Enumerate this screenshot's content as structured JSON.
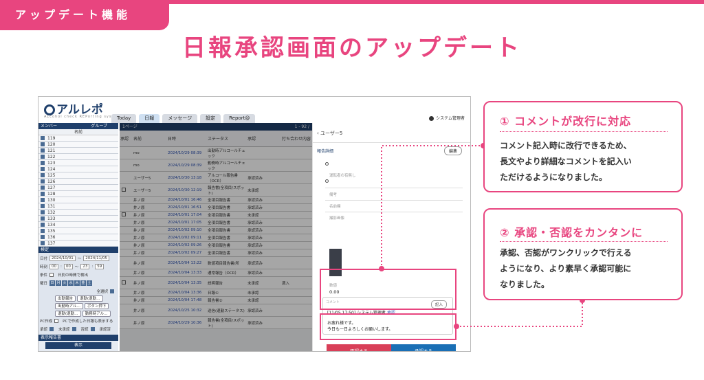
{
  "tag": "アップデート機能",
  "headline": "日報承認画面のアップデート",
  "app": {
    "logo": "アルレポ",
    "logo_sub": "ALcohol check REPorting system",
    "tabs": [
      "Today",
      "日報",
      "メッセージ",
      "設定",
      "Report@"
    ],
    "user": "システム管理者"
  },
  "sidebar": {
    "header": "メンバー",
    "group_label": "グループ",
    "col": "名前",
    "members": [
      "119",
      "120",
      "121",
      "122",
      "123",
      "124",
      "125",
      "126",
      "127",
      "128",
      "130",
      "131",
      "132",
      "133",
      "134",
      "135",
      "136",
      "137"
    ],
    "filter_label": "検定",
    "date_label": "日付",
    "date_from": "2024/10/01",
    "date_to": "2024/11/05",
    "time_label": "時刻",
    "hour_from": "00",
    "min_from": "00",
    "hour_to": "23",
    "min_to": "59",
    "cond_label": "条件",
    "cond_text": "日別の時間で検出",
    "weekday_label": "曜日",
    "weekdays": [
      "日",
      "月",
      "火",
      "水",
      "木",
      "金",
      "土"
    ],
    "select_all": "全選択",
    "chips": [
      "出勤報告",
      "退勤(退勤…",
      "出勤時アル…",
      "ボタン押下",
      "退勤(退勤…",
      "勤務時アル…"
    ],
    "pc_label": "PC作成",
    "pc_text": "PCで作成した日報も表示する",
    "approve_label": "承認",
    "approve_opts": [
      "未承認",
      "否認",
      "承認済"
    ],
    "report_label": "表示報告書",
    "show_button": "表示",
    "note_label": "日付報告書"
  },
  "main": {
    "header": "1ページ",
    "page": "1 - 92 /",
    "cols": [
      "承認",
      "名前",
      "日時",
      "ステータス",
      "承認",
      "打ち合わせ内容"
    ],
    "rows": [
      {
        "name": "mo",
        "date": "2024/10/29 08:39",
        "status": "出勤時アルコールチェック",
        "approve": "",
        "note": ""
      },
      {
        "name": "mo",
        "date": "2024/10/29 08:39",
        "status": "勤務時アルコールチェック",
        "approve": "",
        "note": ""
      },
      {
        "name": "ユーザー5",
        "date": "2024/10/30 13:18",
        "status": "アルコール報告書（OCR）",
        "approve": "承認済み",
        "note": ""
      },
      {
        "name": "ユーザー5",
        "date": "2024/10/30 12:19",
        "status": "報告書(全項目/スポット)",
        "approve": "未承認",
        "note": ""
      },
      {
        "name": "井ノ原",
        "date": "2024/10/01 16:46",
        "status": "全項目報告書",
        "approve": "承認済み",
        "note": ""
      },
      {
        "name": "井ノ原",
        "date": "2024/10/01 16:51",
        "status": "全項目報告書",
        "approve": "承認済み",
        "note": ""
      },
      {
        "name": "井ノ原",
        "date": "2024/10/01 17:04",
        "status": "全項目報告書",
        "approve": "未承認",
        "note": ""
      },
      {
        "name": "井ノ原",
        "date": "2024/10/01 17:05",
        "status": "全項目報告書",
        "approve": "承認済み",
        "note": ""
      },
      {
        "name": "井ノ原",
        "date": "2024/10/02 09:10",
        "status": "全項目報告書",
        "approve": "承認済み",
        "note": ""
      },
      {
        "name": "井ノ原",
        "date": "2024/10/02 09:11",
        "status": "全項目報告書",
        "approve": "承認済み",
        "note": ""
      },
      {
        "name": "井ノ原",
        "date": "2024/10/02 09:26",
        "status": "全項目報告書",
        "approve": "承認済み",
        "note": ""
      },
      {
        "name": "井ノ原",
        "date": "2024/10/02 09:27",
        "status": "全項目報告書",
        "approve": "承認済み",
        "note": ""
      },
      {
        "name": "井ノ原",
        "date": "2024/10/04 13:22",
        "status": "数値項目報告書/所",
        "approve": "承認済み",
        "note": ""
      },
      {
        "name": "井ノ原",
        "date": "2024/10/04 13:33",
        "status": "通常報告（OCR）",
        "approve": "承認済み",
        "note": ""
      },
      {
        "name": "井ノ原",
        "date": "2024/10/04 13:35",
        "status": "説明報告",
        "approve": "未承認",
        "note": "週入"
      },
      {
        "name": "井ノ原",
        "date": "2024/10/04 13:36",
        "status": "日報①",
        "approve": "未承認",
        "note": ""
      },
      {
        "name": "井ノ原",
        "date": "2024/10/04 17:48",
        "status": "報告書②",
        "approve": "未承認",
        "note": ""
      },
      {
        "name": "井ノ原",
        "date": "2024/10/25 10:32",
        "status": "送信(退勤ステータス)",
        "approve": "承認済み",
        "note": ""
      },
      {
        "name": "井ノ原",
        "date": "2024/10/29 10:36",
        "status": "報告書(全項目/スポット)",
        "approve": "承認済み",
        "note": ""
      }
    ]
  },
  "panel": {
    "back": "ユーザー5",
    "section": "報告詳細",
    "edit": "編集",
    "labels": [
      "運転者の有無し",
      "備考",
      "名前欄",
      "撮影画像"
    ],
    "value_label": "数値",
    "value": "0.00",
    "comment_label": "コメント",
    "comment_button": "記入",
    "comment_time": "[11/05 17:50] システム管理者",
    "comment_status": "承認",
    "comment_body_1": "お疲れ様です。",
    "comment_body_2": "今日も一日よろしくお願いします。",
    "deny_button": "否認する",
    "approve_button": "承認する"
  },
  "callouts": [
    {
      "title": "① コメントが改行に対応",
      "lines": [
        "コメント記入時に改行できるため、",
        "長文やより詳細なコメントを記入い",
        "ただけるようになりました。"
      ]
    },
    {
      "title": "② 承認・否認をカンタンに",
      "lines": [
        "承認、否認がワンクリックで行える",
        "ようになり、より素早く承認可能に",
        "なりました。"
      ]
    }
  ],
  "colors": {
    "accent": "#e8457f",
    "navy": "#1f3f6b",
    "deny": "#d93f58",
    "approve": "#1a6fb5"
  }
}
